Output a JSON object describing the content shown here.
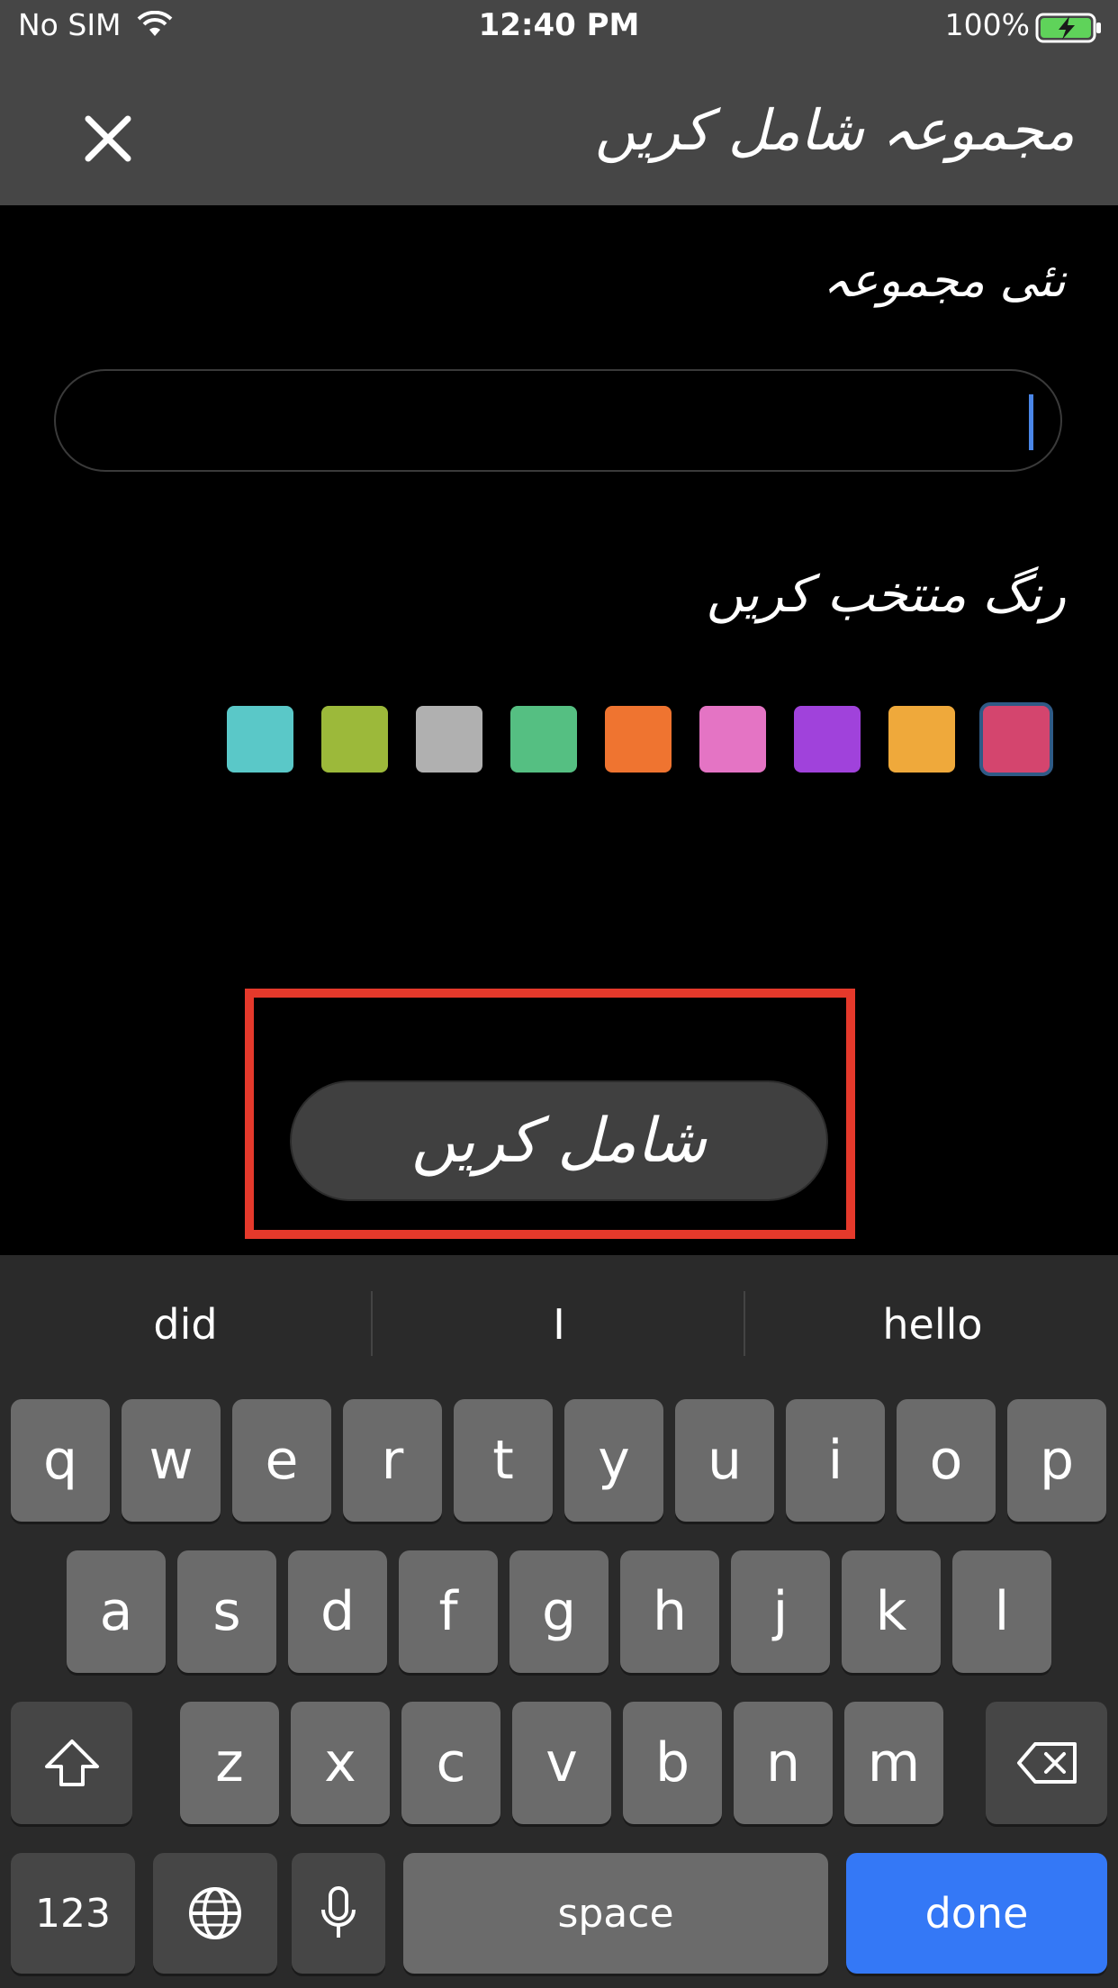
{
  "status_bar": {
    "carrier": "No SIM",
    "time": "12:40 PM",
    "battery": "100%"
  },
  "nav": {
    "title": "مجموعہ شامل کریں",
    "close_icon": "close-icon"
  },
  "form": {
    "new_collection_label": "نئی مجموعہ",
    "name_value": "",
    "choose_color_label": "رنگ منتخب کریں",
    "colors": [
      "#5ac8c8",
      "#9cb93a",
      "#b0b0b0",
      "#55bf82",
      "#ef7430",
      "#e474c4",
      "#a042db",
      "#efa93b",
      "#d4456e"
    ],
    "selected_color_index": 8,
    "add_button_label": "شامل کریں"
  },
  "keyboard": {
    "suggestions": [
      "did",
      "I",
      "hello"
    ],
    "row1": [
      "q",
      "w",
      "e",
      "r",
      "t",
      "y",
      "u",
      "i",
      "o",
      "p"
    ],
    "row2": [
      "a",
      "s",
      "d",
      "f",
      "g",
      "h",
      "j",
      "k",
      "l"
    ],
    "row3": [
      "z",
      "x",
      "c",
      "v",
      "b",
      "n",
      "m"
    ],
    "numbers_key": "123",
    "space_key": "space",
    "done_key": "done"
  }
}
